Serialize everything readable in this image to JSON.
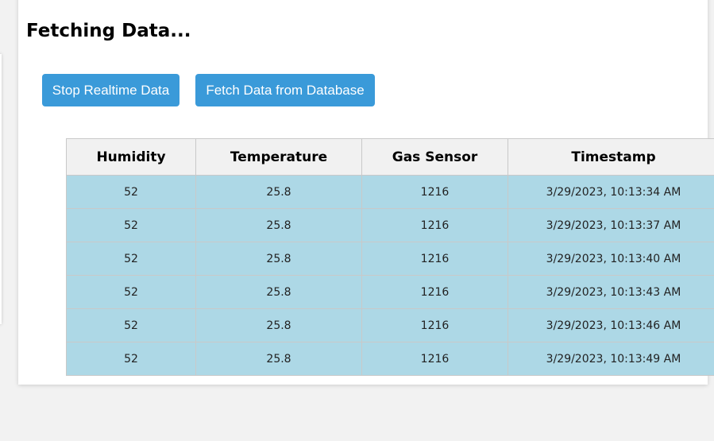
{
  "status": {
    "title": "Fetching Data..."
  },
  "buttons": {
    "stop_realtime": "Stop Realtime Data",
    "fetch_database": "Fetch Data from Database"
  },
  "colors": {
    "button_bg": "#3a9ad9",
    "row_bg": "#add8e6",
    "header_bg": "#f1f1f1"
  },
  "table": {
    "headers": [
      "Humidity",
      "Temperature",
      "Gas Sensor",
      "Timestamp"
    ],
    "rows": [
      {
        "humidity": "52",
        "temperature": "25.8",
        "gas": "1216",
        "timestamp": "3/29/2023, 10:13:34 AM"
      },
      {
        "humidity": "52",
        "temperature": "25.8",
        "gas": "1216",
        "timestamp": "3/29/2023, 10:13:37 AM"
      },
      {
        "humidity": "52",
        "temperature": "25.8",
        "gas": "1216",
        "timestamp": "3/29/2023, 10:13:40 AM"
      },
      {
        "humidity": "52",
        "temperature": "25.8",
        "gas": "1216",
        "timestamp": "3/29/2023, 10:13:43 AM"
      },
      {
        "humidity": "52",
        "temperature": "25.8",
        "gas": "1216",
        "timestamp": "3/29/2023, 10:13:46 AM"
      },
      {
        "humidity": "52",
        "temperature": "25.8",
        "gas": "1216",
        "timestamp": "3/29/2023, 10:13:49 AM"
      }
    ]
  }
}
